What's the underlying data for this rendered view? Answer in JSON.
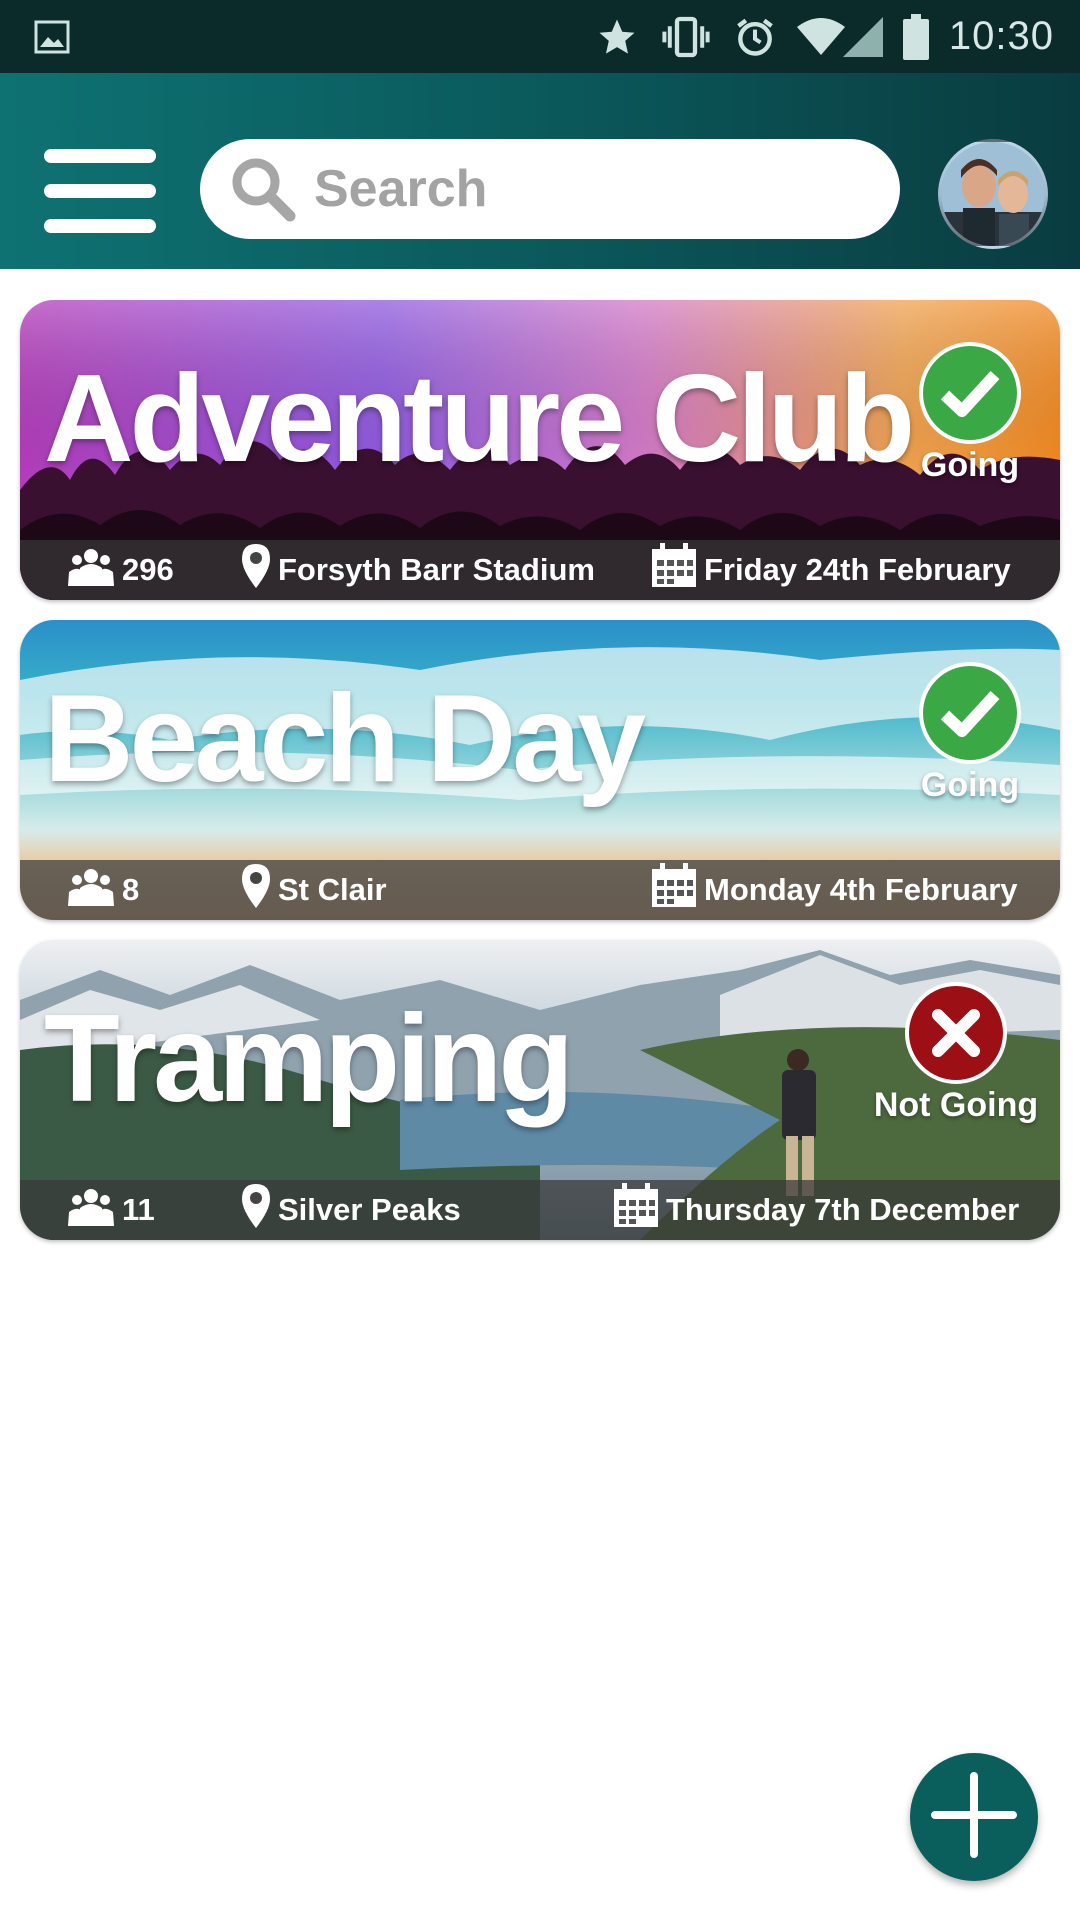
{
  "status_bar": {
    "time": "10:30",
    "icons": [
      "image-icon",
      "star-icon",
      "vibrate-icon",
      "alarm-icon",
      "wifi-icon",
      "signal-icon",
      "battery-icon"
    ]
  },
  "app_bar": {
    "menu_icon": "menu-icon",
    "search": {
      "placeholder": "Search",
      "value": "",
      "icon": "search-icon"
    },
    "avatar_icon": "avatar"
  },
  "colors": {
    "app_bar": "#0b5c5e",
    "going": "#3aa845",
    "not_going": "#9c0f14",
    "fab": "#0a5e5b"
  },
  "events": [
    {
      "title": "Adventure Club",
      "rsvp_status": "Going",
      "rsvp_icon": "check-icon",
      "attendees": "296",
      "location": "Forsyth Barr Stadium",
      "date": "Friday 24th February"
    },
    {
      "title": "Beach Day",
      "rsvp_status": "Going",
      "rsvp_icon": "check-icon",
      "attendees": "8",
      "location": "St Clair",
      "date": "Monday 4th February"
    },
    {
      "title": "Tramping",
      "rsvp_status": "Not Going",
      "rsvp_icon": "cross-icon",
      "attendees": "11",
      "location": "Silver Peaks",
      "date": "Thursday 7th December"
    }
  ],
  "fab": {
    "icon": "plus-icon"
  }
}
